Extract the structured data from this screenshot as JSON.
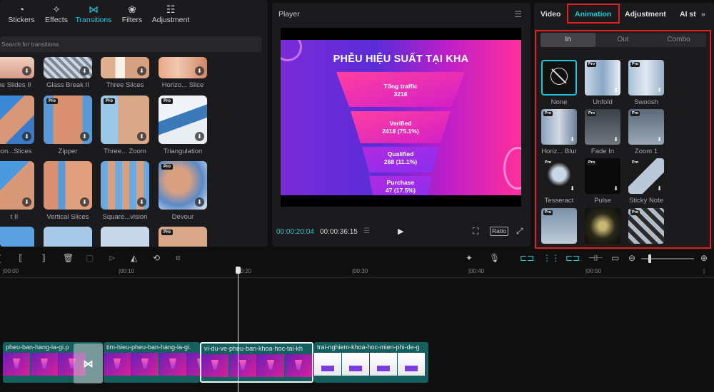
{
  "left_panel": {
    "tabs": [
      {
        "label": "Stickers",
        "icon": "sticker-icon"
      },
      {
        "label": "Effects",
        "icon": "effects-icon"
      },
      {
        "label": "Transitions",
        "icon": "transition-icon"
      },
      {
        "label": "Filters",
        "icon": "filters-icon"
      },
      {
        "label": "Adjustment",
        "icon": "sliders-icon"
      }
    ],
    "active_tab": "Transitions",
    "search_placeholder": "Search for transitions",
    "transitions": [
      {
        "label": "ee Slides II"
      },
      {
        "label": "Glass Break II"
      },
      {
        "label": "Three Slices"
      },
      {
        "label": "Horizo... Slice"
      },
      {
        "label": "gon...Slices"
      },
      {
        "label": "Zipper",
        "pro": "Pro"
      },
      {
        "label": "Three... Zoom",
        "pro": "Pro"
      },
      {
        "label": "Triangulation",
        "pro": "Pro"
      },
      {
        "label": "t II"
      },
      {
        "label": "Vertical Slices"
      },
      {
        "label": "Square...vision"
      },
      {
        "label": "Devour",
        "pro": "Pro"
      }
    ]
  },
  "player": {
    "title": "Player",
    "slide_title": "PHỄU HIỆU SUẤT TẠI KHA",
    "funnel": [
      {
        "name": "Tổng traffic",
        "value": "3218"
      },
      {
        "name": "Verified",
        "value": "2418 (75.1%)"
      },
      {
        "name": "Qualified",
        "value": "268 (11.1%)"
      },
      {
        "name": "Purchase",
        "value": "47 (17.5%)"
      }
    ],
    "current_time": "00:00:20:04",
    "total_time": "00:00:36:15",
    "ratio_label": "Ratio"
  },
  "right_panel": {
    "tabs": [
      "Video",
      "Animation",
      "Adjustment",
      "AI st"
    ],
    "active_tab": "Animation",
    "segments": [
      "In",
      "Out",
      "Combo"
    ],
    "active_segment": "In",
    "animations": [
      {
        "label": "None"
      },
      {
        "label": "Unfold",
        "pro": "Pro"
      },
      {
        "label": "Swoosh",
        "pro": "Pro"
      },
      {
        "label": "Horiz... Blur",
        "pro": "Pro"
      },
      {
        "label": "Fade In",
        "pro": "Pro"
      },
      {
        "label": "Zoom 1",
        "pro": "Pro"
      },
      {
        "label": "Tesseract",
        "pro": "Pro"
      },
      {
        "label": "Pulse",
        "pro": "Pro"
      },
      {
        "label": "Sticky Note",
        "pro": "Pro"
      },
      {
        "label": "",
        "pro": "Pro"
      },
      {
        "label": ""
      },
      {
        "label": "",
        "pro": "Pro"
      }
    ],
    "highlight_color": "#e02020"
  },
  "timeline": {
    "ruler": [
      "|00:00",
      "|00:10",
      "|00:20",
      "|00:30",
      "|00:40",
      "|00:50"
    ],
    "clips": [
      {
        "name": "pheu-ban-hang-la-gi.p"
      },
      {
        "name": "tim-hieu-pheu-ban-hang-la-gi."
      },
      {
        "name": "vi-du-ve-pheu-ban-khoa-hoc-tai-kh"
      },
      {
        "name": "trai-nghiem-khoa-hoc-mien-phi-de-g"
      }
    ],
    "transition_icon": "bowtie-transition-icon",
    "accent": "#1ec8d8"
  }
}
